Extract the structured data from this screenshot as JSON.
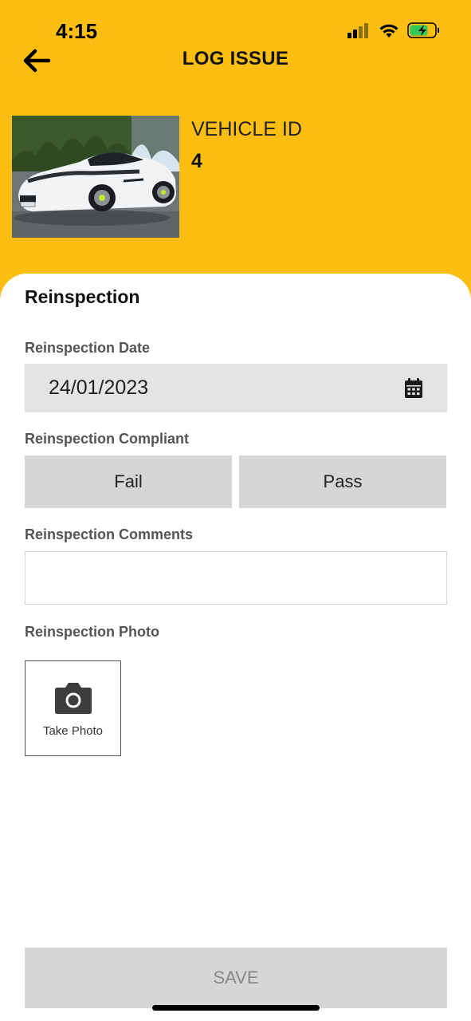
{
  "status_bar": {
    "time": "4:15",
    "icons": [
      "cellular-signal-icon",
      "wifi-icon",
      "battery-charging-icon"
    ],
    "battery_color": "#34C759"
  },
  "nav": {
    "back_icon": "arrow-left-icon",
    "title": "LOG ISSUE"
  },
  "vehicle": {
    "photo": "sports-car-photo",
    "label": "VEHICLE ID",
    "id": "4"
  },
  "form": {
    "section_title": "Reinspection",
    "date": {
      "label": "Reinspection Date",
      "value": "24/01/2023",
      "icon": "calendar-icon"
    },
    "compliant": {
      "label": "Reinspection Compliant",
      "options": [
        "Fail",
        "Pass"
      ]
    },
    "comments": {
      "label": "Reinspection Comments",
      "value": ""
    },
    "photo": {
      "label": "Reinspection Photo",
      "icon": "camera-icon",
      "caption": "Take Photo"
    }
  },
  "footer": {
    "save_label": "SAVE"
  },
  "colors": {
    "header_bg": "#FCBE13",
    "field_bg": "#E4E4E4",
    "button_bg": "#D6D6D6",
    "disabled_text": "#888888"
  }
}
